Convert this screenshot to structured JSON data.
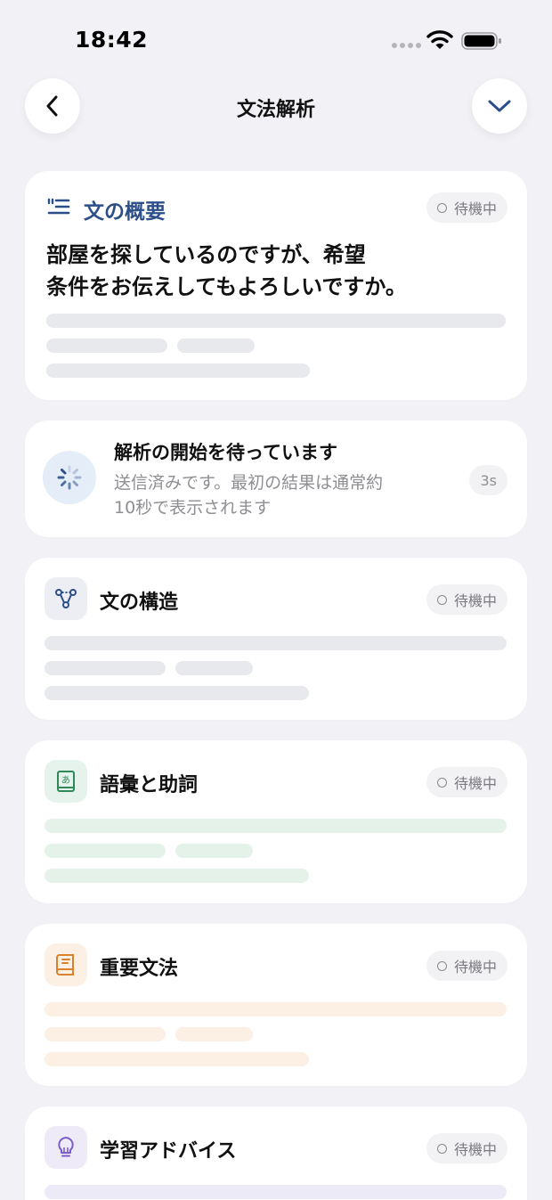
{
  "status_bar": {
    "time": "18:42"
  },
  "nav": {
    "title": "文法解析"
  },
  "summary_card": {
    "title": "文の概要",
    "badge": "待機中",
    "sentence_line1": "部屋を探しているのですが、希望",
    "sentence_line2": "条件をお伝えしてもよろしいですか。"
  },
  "waiting_card": {
    "title": "解析の開始を待っています",
    "subtitle_line1": "送信済みです。最初の結果は通常約",
    "subtitle_line2": "10秒で表示されます",
    "timer": "3s"
  },
  "sections": [
    {
      "title": "文の構造",
      "badge": "待機中",
      "icon": "structure-icon",
      "accent": "#2c4f8a"
    },
    {
      "title": "語彙と助詞",
      "badge": "待機中",
      "icon": "vocabulary-book-icon",
      "accent": "#2e8b57"
    },
    {
      "title": "重要文法",
      "badge": "待機中",
      "icon": "grammar-book-icon",
      "accent": "#d9822b"
    },
    {
      "title": "学習アドバイス",
      "badge": "待機中",
      "icon": "lightbulb-icon",
      "accent": "#7b5cc9"
    }
  ]
}
